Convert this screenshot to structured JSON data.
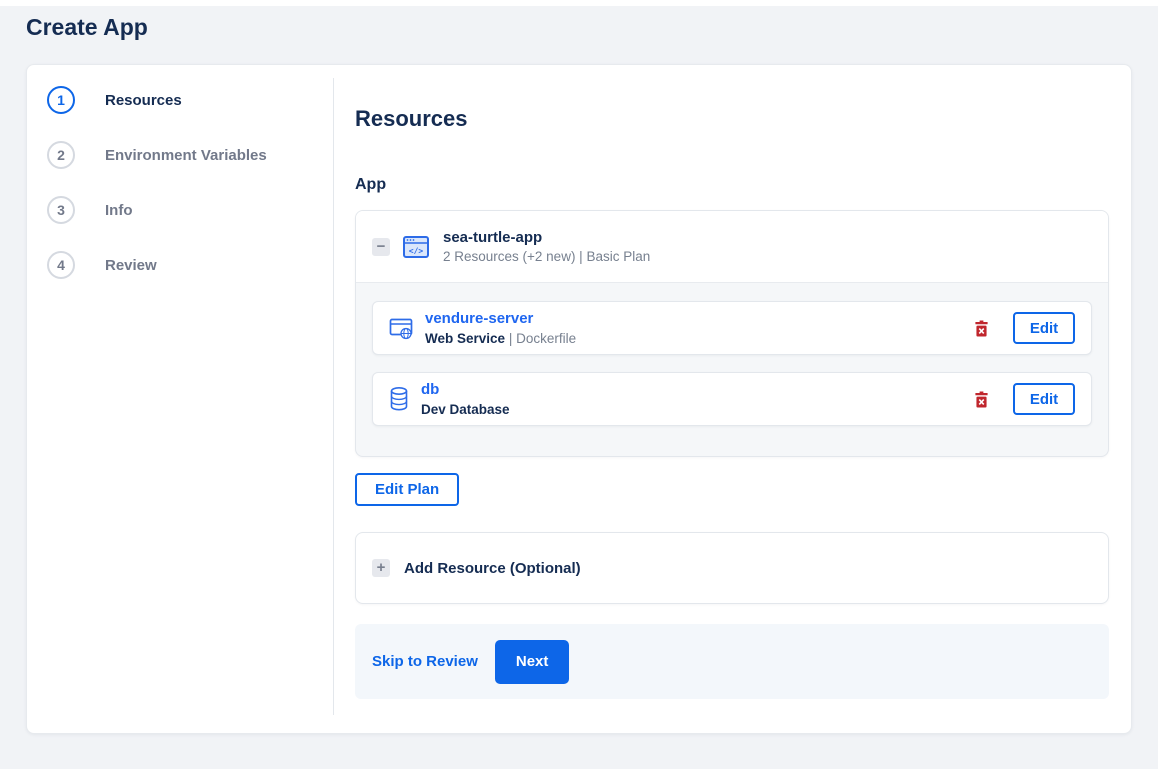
{
  "page": {
    "title": "Create App"
  },
  "steps": [
    {
      "number": "1",
      "label": "Resources"
    },
    {
      "number": "2",
      "label": "Environment Variables"
    },
    {
      "number": "3",
      "label": "Info"
    },
    {
      "number": "4",
      "label": "Review"
    }
  ],
  "main": {
    "heading": "Resources",
    "section_label": "App",
    "app_group": {
      "icon": "app-window-code-icon",
      "collapse_glyph": "−",
      "name": "sea-turtle-app",
      "summary": "2 Resources (+2 new) | Basic Plan",
      "edit_label": "Edit",
      "resources": [
        {
          "icon": "web-service-icon",
          "name": "vendure-server",
          "type": "Web Service",
          "detail": "| Dockerfile"
        },
        {
          "icon": "database-icon",
          "name": "db",
          "type": "Dev Database",
          "detail": ""
        }
      ]
    },
    "edit_plan_label": "Edit Plan",
    "add_resource": {
      "expand_glyph": "+",
      "label": "Add Resource (Optional)"
    },
    "footer": {
      "skip_label": "Skip to Review",
      "next_label": "Next"
    }
  },
  "colors": {
    "primary_blue": "#0d66e8",
    "link_blue": "#1f66f0",
    "navy_text": "#152c52",
    "secondary_gray": "#77808f",
    "danger_red": "#c0262d",
    "border_gray": "#e3e7ec",
    "page_background": "#f1f3f6",
    "footer_background": "#f3f7fb"
  }
}
